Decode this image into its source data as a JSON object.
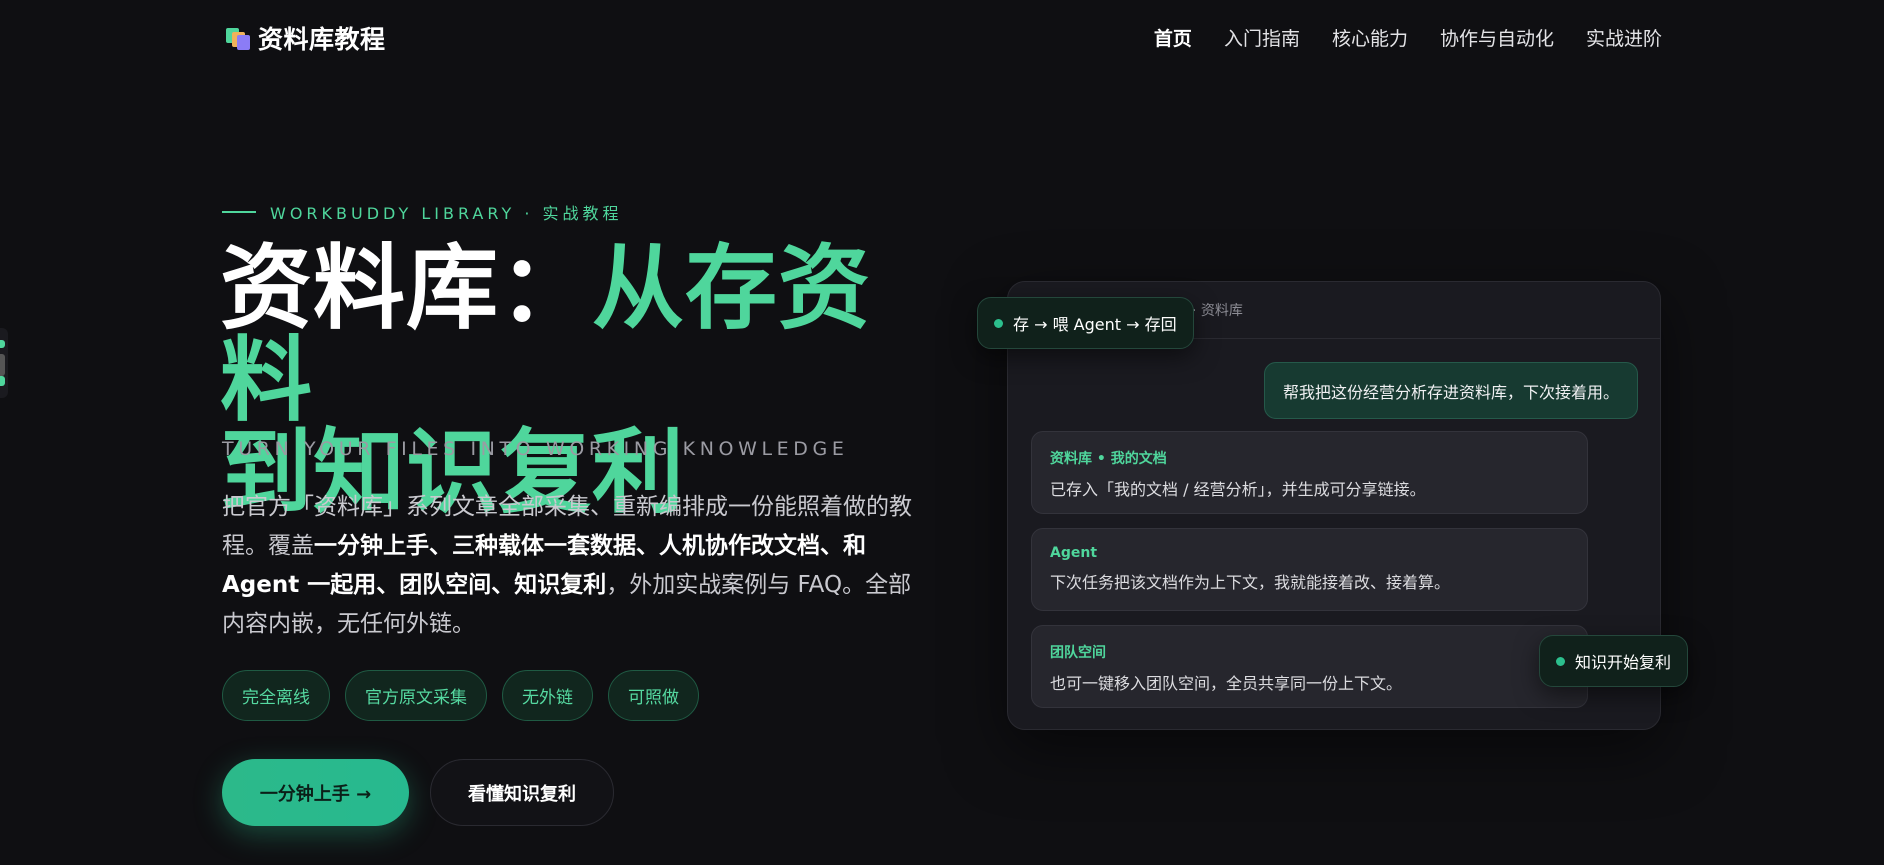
{
  "nav": {
    "brand": "资料库教程",
    "items": [
      {
        "label": "首页",
        "active": true
      },
      {
        "label": "入门指南"
      },
      {
        "label": "核心能力"
      },
      {
        "label": "协作与自动化"
      },
      {
        "label": "实战进阶"
      }
    ]
  },
  "hero": {
    "eyebrow": "WORKBUDDY LIBRARY · 实战教程",
    "title_plain": "资料库：",
    "title_accent_1": "从存资料",
    "title_accent_2": "到知识复利",
    "subtitle_en": "TURN YOUR FILES INTO WORKING KNOWLEDGE",
    "desc_1": "把官方「资料库」系列文章全部采集、重新编排成一份能照着做的教程。覆盖",
    "desc_bold": "一分钟上手、三种载体一套数据、人机协作改文档、和 Agent 一起用、团队空间、知识复利",
    "desc_2": "，外加实战案例与 FAQ。全部内容内嵌，无任何外链。",
    "chips": [
      "完全离线",
      "官方原文采集",
      "无外链",
      "可照做"
    ],
    "primary_cta": "一分钟上手 →",
    "secondary_cta": "看懂知识复利"
  },
  "card": {
    "header": "· 资料库",
    "user_message": "帮我把这份经营分析存进资料库，下次接着用。",
    "messages": [
      {
        "who": "资料库 • 我的文档",
        "text": "已存入「我的文档 / 经营分析」，并生成可分享链接。"
      },
      {
        "who": "Agent",
        "text": "下次任务把该文档作为上下文，我就能接着改、接着算。"
      },
      {
        "who": "团队空间",
        "text": "也可一键移入团队空间，全员共享同一份上下文。"
      }
    ],
    "pill_top": "存 → 喂 Agent → 存回",
    "pill_bottom": "知识开始复利"
  },
  "colors": {
    "accent": "#4fd69c",
    "background": "#0f0f12",
    "card": "#1a1a20"
  }
}
